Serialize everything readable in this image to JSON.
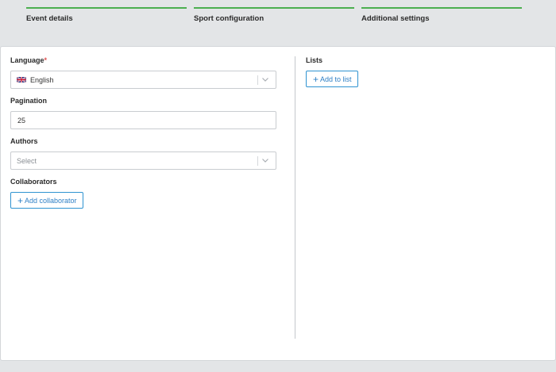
{
  "steps": [
    {
      "label": "Event details"
    },
    {
      "label": "Sport configuration"
    },
    {
      "label": "Additional settings"
    }
  ],
  "form": {
    "language": {
      "label": "Language",
      "required_mark": "*",
      "value": "English"
    },
    "pagination": {
      "label": "Pagination",
      "value": "25"
    },
    "authors": {
      "label": "Authors",
      "placeholder": "Select"
    },
    "collaborators": {
      "label": "Collaborators",
      "button_label": "Add collaborator"
    }
  },
  "lists": {
    "label": "Lists",
    "button_label": "Add to list"
  },
  "icons": {
    "plus": "plus-icon",
    "chevron": "chevron-down-icon",
    "flag": "uk-flag-icon"
  },
  "colors": {
    "step_bar": "#4caf50",
    "accent": "#2f80c6",
    "required": "#e05252"
  }
}
